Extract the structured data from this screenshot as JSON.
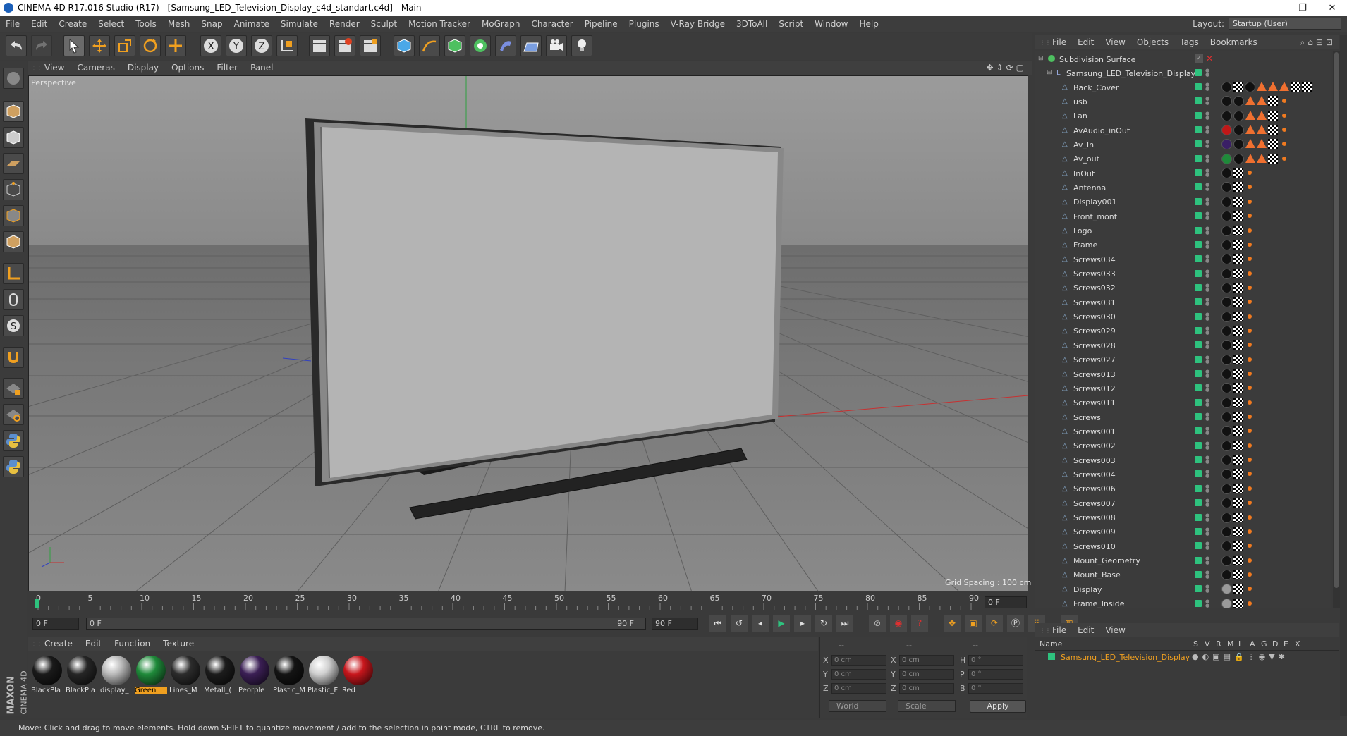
{
  "window": {
    "title": "CINEMA 4D R17.016 Studio (R17) - [Samsung_LED_Television_Display_c4d_standart.c4d] - Main",
    "min": "—",
    "max": "❐",
    "close": "✕"
  },
  "menubar": {
    "items": [
      "File",
      "Edit",
      "Create",
      "Select",
      "Tools",
      "Mesh",
      "Snap",
      "Animate",
      "Simulate",
      "Render",
      "Sculpt",
      "Motion Tracker",
      "MoGraph",
      "Character",
      "Pipeline",
      "Plugins",
      "V-Ray Bridge",
      "3DToAll",
      "Script",
      "Window",
      "Help"
    ],
    "layout_label": "Layout:",
    "layout_value": "Startup (User)"
  },
  "viewport": {
    "menu": [
      "View",
      "Cameras",
      "Display",
      "Options",
      "Filter",
      "Panel"
    ],
    "label": "Perspective",
    "grid_spacing": "Grid Spacing : 100 cm"
  },
  "timeline": {
    "ticks": [
      "0",
      "5",
      "10",
      "15",
      "20",
      "25",
      "30",
      "35",
      "40",
      "45",
      "50",
      "55",
      "60",
      "65",
      "70",
      "75",
      "80",
      "85",
      "90"
    ],
    "frame_field": "0 F",
    "start_field": "0 F",
    "range_start": "0 F",
    "range_end": "90 F",
    "end_field": "90 F"
  },
  "materials": {
    "menu": [
      "Create",
      "Edit",
      "Function",
      "Texture"
    ],
    "items": [
      {
        "label": "BlackPla",
        "color": "#1a1a1a",
        "selected": false
      },
      {
        "label": "BlackPla",
        "color": "#262626",
        "selected": false
      },
      {
        "label": "display_",
        "color": "#b9b9b9",
        "selected": false
      },
      {
        "label": "Green",
        "color": "#1f8a3a",
        "selected": true
      },
      {
        "label": "Lines_M",
        "color": "#2c2c2c",
        "selected": false
      },
      {
        "label": "Metall_(",
        "color": "#1c1c1c",
        "selected": false
      },
      {
        "label": "Peorple",
        "color": "#3b1f55",
        "selected": false
      },
      {
        "label": "Plastic_M",
        "color": "#141414",
        "selected": false
      },
      {
        "label": "Plastic_F",
        "color": "#cfcfcf",
        "selected": false
      },
      {
        "label": "Red",
        "color": "#c8161c",
        "selected": false
      }
    ]
  },
  "coords": {
    "header": [
      "--",
      "--",
      "--"
    ],
    "rows": [
      {
        "a": "X",
        "av": "0 cm",
        "b": "X",
        "bv": "0 cm",
        "c": "H",
        "cv": "0 °"
      },
      {
        "a": "Y",
        "av": "0 cm",
        "b": "Y",
        "bv": "0 cm",
        "c": "P",
        "cv": "0 °"
      },
      {
        "a": "Z",
        "av": "0 cm",
        "b": "Z",
        "bv": "0 cm",
        "c": "B",
        "cv": "0 °"
      }
    ],
    "world": "World",
    "scale": "Scale",
    "apply": "Apply"
  },
  "objects": {
    "menu": [
      "File",
      "Edit",
      "View",
      "Objects",
      "Tags",
      "Bookmarks"
    ],
    "root": "Subdivision Surface",
    "group": "Samsung_LED_Television_Display",
    "children": [
      {
        "name": "Back_Cover",
        "tags": "full"
      },
      {
        "name": "usb",
        "tags": "mid"
      },
      {
        "name": "Lan",
        "tags": "mid"
      },
      {
        "name": "AvAudio_inOut",
        "tags": "mid_red"
      },
      {
        "name": "Av_In",
        "tags": "mid_purple"
      },
      {
        "name": "Av_out",
        "tags": "mid_green"
      },
      {
        "name": "InOut",
        "tags": "small"
      },
      {
        "name": "Antenna",
        "tags": "small"
      },
      {
        "name": "Display001",
        "tags": "small"
      },
      {
        "name": "Front_mont",
        "tags": "small"
      },
      {
        "name": "Logo",
        "tags": "small"
      },
      {
        "name": "Frame",
        "tags": "small"
      },
      {
        "name": "Screws034",
        "tags": "small"
      },
      {
        "name": "Screws033",
        "tags": "small"
      },
      {
        "name": "Screws032",
        "tags": "small"
      },
      {
        "name": "Screws031",
        "tags": "small"
      },
      {
        "name": "Screws030",
        "tags": "small"
      },
      {
        "name": "Screws029",
        "tags": "small"
      },
      {
        "name": "Screws028",
        "tags": "small"
      },
      {
        "name": "Screws027",
        "tags": "small"
      },
      {
        "name": "Screws013",
        "tags": "small"
      },
      {
        "name": "Screws012",
        "tags": "small"
      },
      {
        "name": "Screws011",
        "tags": "small"
      },
      {
        "name": "Screws",
        "tags": "small"
      },
      {
        "name": "Screws001",
        "tags": "small"
      },
      {
        "name": "Screws002",
        "tags": "small"
      },
      {
        "name": "Screws003",
        "tags": "small"
      },
      {
        "name": "Screws004",
        "tags": "small"
      },
      {
        "name": "Screws006",
        "tags": "small"
      },
      {
        "name": "Screws007",
        "tags": "small"
      },
      {
        "name": "Screws008",
        "tags": "small"
      },
      {
        "name": "Screws009",
        "tags": "small"
      },
      {
        "name": "Screws010",
        "tags": "small"
      },
      {
        "name": "Mount_Geometry",
        "tags": "small"
      },
      {
        "name": "Mount_Base",
        "tags": "small"
      },
      {
        "name": "Display",
        "tags": "small_grey"
      },
      {
        "name": "Frame_Inside",
        "tags": "small_grey"
      }
    ]
  },
  "attributes": {
    "menu": [
      "File",
      "Edit",
      "View"
    ],
    "name_header": "Name",
    "cols": [
      "S",
      "V",
      "R",
      "M",
      "L",
      "A",
      "G",
      "D",
      "E",
      "X"
    ],
    "row": "Samsung_LED_Television_Display"
  },
  "status": "Move: Click and drag to move elements. Hold down SHIFT to quantize movement / add to the selection in point mode, CTRL to remove.",
  "brand": {
    "maxon": "MAXON",
    "cinema": "CINEMA 4D"
  },
  "colors": {
    "accent": "#f0a020",
    "visible": "#2ec27e",
    "axis_x": "#c83030",
    "axis_y": "#2fa040"
  }
}
